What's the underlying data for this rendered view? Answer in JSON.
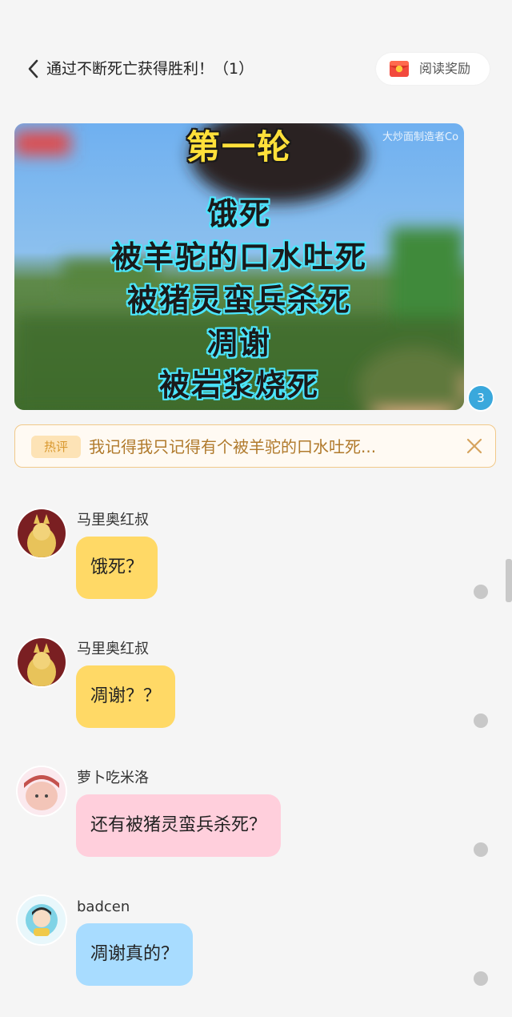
{
  "header": {
    "title": "通过不断死亡获得胜利！（1）",
    "reward_label": "阅读奖励"
  },
  "scene": {
    "watermark": "大炒面制造者Co",
    "lines": [
      "第一轮",
      "饿死",
      "被羊驼的口水吐死",
      "被猪灵蛮兵杀死",
      "凋谢",
      "被岩浆烧死"
    ]
  },
  "badge_count": "3",
  "hot_comment": {
    "tag": "热评",
    "text": "我记得我只记得有个被羊驼的口水吐死..."
  },
  "comments": [
    {
      "username": "马里奥红叔",
      "text": "饿死？",
      "bubble_color": "#ffd966"
    },
    {
      "username": "马里奥红叔",
      "text": "凋谢？？",
      "bubble_color": "#ffd966"
    },
    {
      "username": "萝卜吃米洛",
      "text": "还有被猪灵蛮兵杀死？",
      "bubble_color": "#ffcfdc"
    },
    {
      "username": "badcen",
      "text": "凋谢真的？",
      "bubble_color": "#a8dcff"
    }
  ],
  "icons": {
    "back": "chevron-left-icon",
    "reward": "red-envelope-icon",
    "close": "close-icon"
  }
}
